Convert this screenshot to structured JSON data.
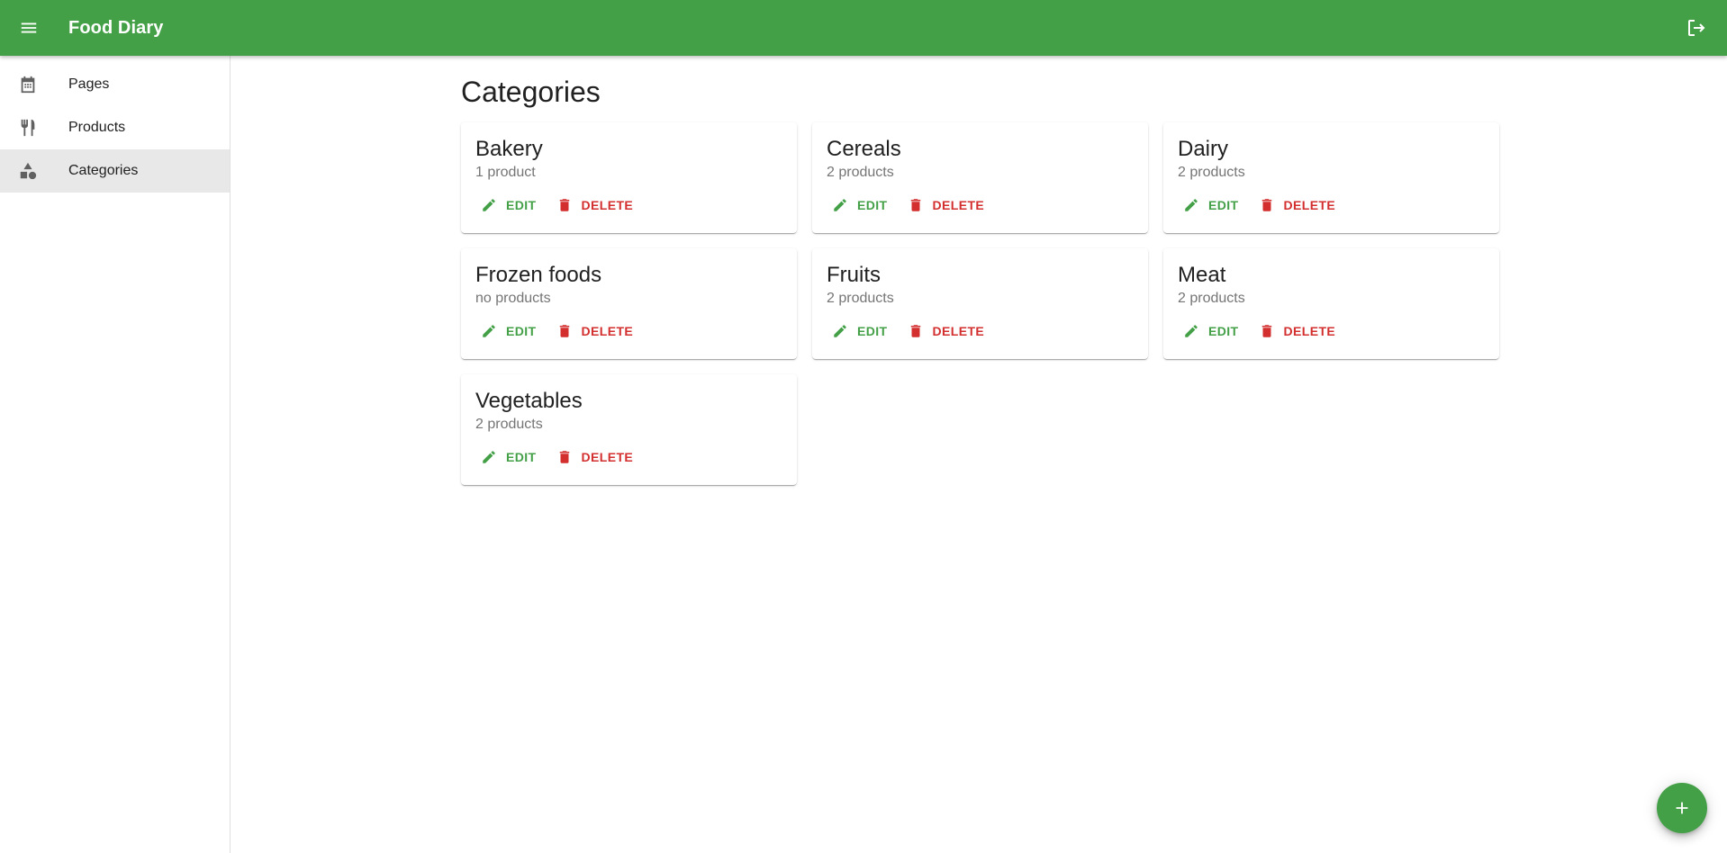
{
  "app": {
    "title": "Food Diary",
    "colors": {
      "primary": "#43a047",
      "danger": "#d32f2f",
      "muted": "#757575"
    },
    "icons": {
      "menu": "menu-icon",
      "logout": "logout-icon",
      "add": "add-icon"
    }
  },
  "sidebar": {
    "items": [
      {
        "label": "Pages",
        "icon": "calendar-icon",
        "active": false
      },
      {
        "label": "Products",
        "icon": "fork-knife-icon",
        "active": false
      },
      {
        "label": "Categories",
        "icon": "shapes-icon",
        "active": true
      }
    ]
  },
  "main": {
    "title": "Categories",
    "edit_label": "EDIT",
    "delete_label": "DELETE",
    "categories": [
      {
        "name": "Bakery",
        "count": "1 product"
      },
      {
        "name": "Cereals",
        "count": "2 products"
      },
      {
        "name": "Dairy",
        "count": "2 products"
      },
      {
        "name": "Frozen foods",
        "count": "no products"
      },
      {
        "name": "Fruits",
        "count": "2 products"
      },
      {
        "name": "Meat",
        "count": "2 products"
      },
      {
        "name": "Vegetables",
        "count": "2 products"
      }
    ]
  }
}
